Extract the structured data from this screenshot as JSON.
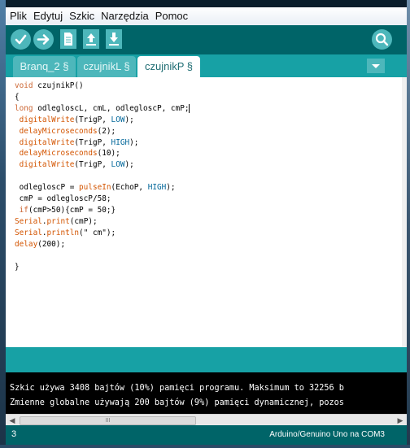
{
  "menu": [
    "Plik",
    "Edytuj",
    "Szkic",
    "Narzędzia",
    "Pomoc"
  ],
  "toolbar": {
    "verify_icon": "check-icon",
    "upload_icon": "arrow-right-icon",
    "new_icon": "file-icon",
    "open_icon": "arrow-up-icon",
    "save_icon": "arrow-down-icon",
    "serial_monitor_icon": "magnifier-icon"
  },
  "tabs": [
    {
      "label": "Branq_2 §",
      "active": false
    },
    {
      "label": "czujnikL §",
      "active": false
    },
    {
      "label": "czujnikP §",
      "active": true
    }
  ],
  "code_lines": [
    "void czujnikP()",
    "{",
    "long odlegloscL, cmL, odlegloscP, cmP;",
    " digitalWrite(TrigP, LOW);",
    " delayMicroseconds(2);",
    " digitalWrite(TrigP, HIGH);",
    " delayMicroseconds(10);",
    " digitalWrite(TrigP, LOW);",
    "",
    " odlegloscP = pulseIn(EchoP, HIGH);",
    " cmP = odlegloscP/58;",
    " if(cmP>50){cmP = 50;}",
    "Serial.print(cmP);",
    "Serial.println(\" cm\");",
    "delay(200);",
    "",
    "}"
  ],
  "console": [
    "Szkic używa 3408 bajtów (10%) pamięci programu. Maksimum to 32256 b",
    "Zmienne globalne używają 200 bajtów (9%) pamięci dynamicznej, pozos"
  ],
  "scrollbar": {
    "left": "◀",
    "right": "▶",
    "grip": "III"
  },
  "footer": {
    "line_number": "3",
    "board": "Arduino/Genuino Uno na COM3"
  },
  "colors": {
    "toolbar": "#006468",
    "tabbar": "#17a1a5",
    "button": "#4db7bb",
    "keyword": "#cc6633"
  }
}
